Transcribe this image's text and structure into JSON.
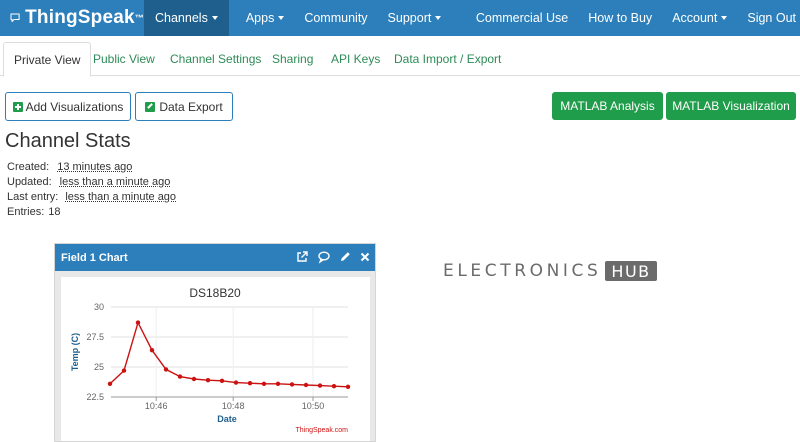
{
  "brand": {
    "name": "ThingSpeak",
    "tm": "™"
  },
  "nav": {
    "channels": "Channels",
    "apps": "Apps",
    "community": "Community",
    "support": "Support",
    "commercial": "Commercial Use",
    "how_to_buy": "How to Buy",
    "account": "Account",
    "sign_out": "Sign Out"
  },
  "tabs": [
    "Private View",
    "Public View",
    "Channel Settings",
    "Sharing",
    "API Keys",
    "Data Import / Export"
  ],
  "buttons": {
    "add_viz": "Add Visualizations",
    "data_export": "Data Export",
    "matlab_analysis": "MATLAB Analysis",
    "matlab_viz": "MATLAB Visualization"
  },
  "stats": {
    "title": "Channel Stats",
    "created_label": "Created:",
    "created_value": "13 minutes ago",
    "updated_label": "Updated:",
    "updated_value": "less than a minute ago",
    "last_entry_label": "Last entry:",
    "last_entry_value": "less than a minute ago",
    "entries_label": "Entries:",
    "entries_value": "18"
  },
  "widget": {
    "title": "Field 1 Chart"
  },
  "watermark": {
    "text": "ELECTRONICS",
    "box": "HUB"
  },
  "colors": {
    "navbar": "#2c7fbb",
    "accent_green": "#1f9d4a",
    "series": "#cc1111",
    "link_green": "#2e8b57"
  },
  "chart_data": {
    "type": "line",
    "title": "DS18B20",
    "xlabel": "Date",
    "ylabel": "Temp (C)",
    "credit": "ThingSpeak.com",
    "x_ticks": [
      "10:46",
      "10:48",
      "10:50"
    ],
    "y_ticks": [
      22.5,
      25,
      27.5,
      30
    ],
    "ylim": [
      22.5,
      30
    ],
    "grid": true,
    "series": [
      {
        "values": [
          23.6,
          24.7,
          28.7,
          26.4,
          24.8,
          24.2,
          24.0,
          23.9,
          23.85,
          23.7,
          23.65,
          23.6,
          23.6,
          23.55,
          23.5,
          23.45,
          23.4,
          23.35
        ]
      }
    ]
  }
}
